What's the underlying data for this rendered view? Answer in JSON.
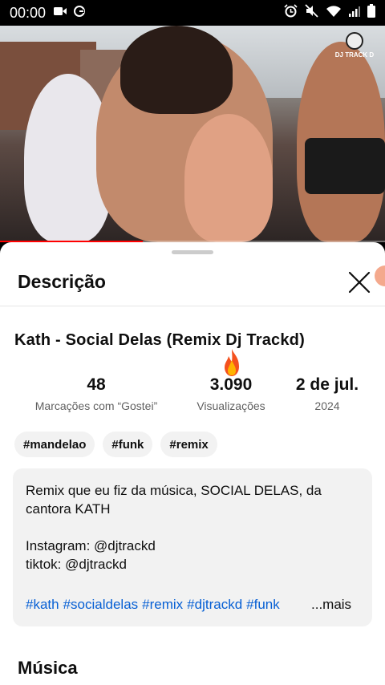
{
  "status_bar": {
    "time": "00:00"
  },
  "video": {
    "watermark": "DJ TRACK D",
    "progress_fraction": 0.37
  },
  "panel": {
    "title": "Descrição",
    "video_title": "Kath - Social Delas (Remix Dj Trackd)",
    "stats": [
      {
        "value": "48",
        "label": "Marcações com “Gostei”"
      },
      {
        "value": "3.090",
        "label": "Visualizações"
      },
      {
        "value": "2 de jul.",
        "label": "2024"
      }
    ],
    "tags": [
      "#mandelao",
      "#funk",
      "#remix"
    ],
    "description": {
      "line1": "Remix que eu fiz da música, SOCIAL DELAS, da",
      "line2": "cantora KATH",
      "instagram": "Instagram: @djtrackd",
      "tiktok": "tiktok: @djtrackd",
      "hashtags": [
        "#kath",
        "#socialdelas",
        "#remix",
        "#djtrackd",
        "#funk"
      ],
      "more_label": "...mais"
    },
    "music_heading": "Música"
  },
  "colors": {
    "accent_link": "#065fd4",
    "progress": "#ff0000"
  }
}
